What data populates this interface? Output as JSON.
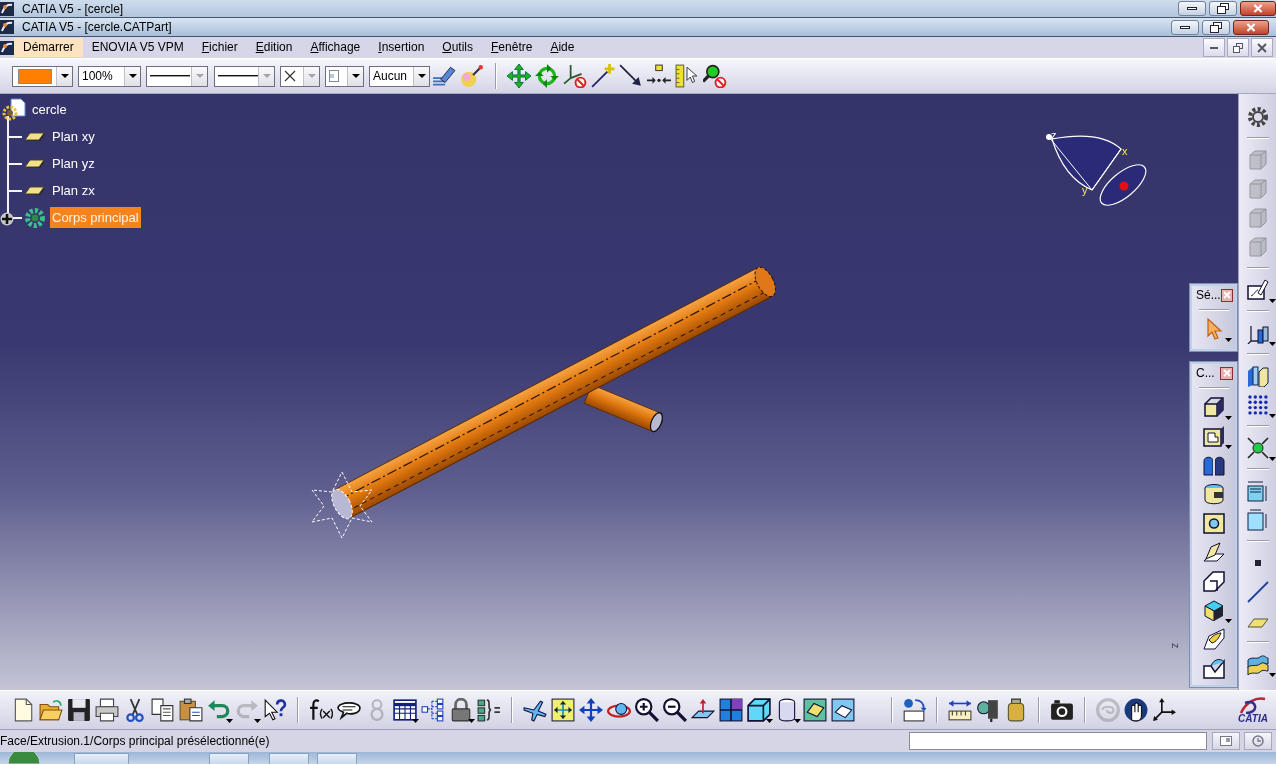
{
  "window": {
    "title": "CATIA V5 - [cercle]"
  },
  "document_window": {
    "title": "CATIA V5 - [cercle.CATPart]"
  },
  "menu_bar": [
    {
      "label": "Démarrer",
      "selected": true,
      "mnemonic": false
    },
    {
      "label": "ENOVIA V5 VPM",
      "selected": false,
      "mnemonic": false
    },
    {
      "label": "Fichier",
      "selected": false,
      "mnemonic": true
    },
    {
      "label": "Edition",
      "selected": false,
      "mnemonic": true
    },
    {
      "label": "Affichage",
      "selected": false,
      "mnemonic": true
    },
    {
      "label": "Insertion",
      "selected": false,
      "mnemonic": true
    },
    {
      "label": "Outils",
      "selected": false,
      "mnemonic": true
    },
    {
      "label": "Fenêtre",
      "selected": false,
      "mnemonic": true
    },
    {
      "label": "Aide",
      "selected": false,
      "mnemonic": true
    }
  ],
  "properties_toolbar": {
    "dropdowns": [
      {
        "kind": "color",
        "color": "#ff8000",
        "disabled": false
      },
      {
        "kind": "percent",
        "value": "100%",
        "disabled": false
      },
      {
        "kind": "thickness",
        "disabled": true
      },
      {
        "kind": "linetype",
        "disabled": true
      },
      {
        "kind": "point",
        "disabled": true
      },
      {
        "kind": "render",
        "disabled": false
      },
      {
        "kind": "layer",
        "value": "Aucun",
        "disabled": false
      }
    ],
    "groups": [
      {
        "buttons": [
          {
            "disabled": false
          },
          {
            "disabled": false
          }
        ]
      },
      {
        "buttons": [
          {
            "disabled": false
          },
          {
            "disabled": false
          },
          {
            "disabled": false
          },
          {
            "disabled": false
          },
          {
            "disabled": false
          },
          {
            "disabled": false
          },
          {
            "disabled": false
          },
          {
            "disabled": false
          }
        ]
      }
    ]
  },
  "tree": {
    "label": "cercle",
    "kind": "part",
    "selected": false,
    "children": [
      {
        "label": "Plan xy",
        "kind": "plane",
        "selected": false
      },
      {
        "label": "Plan yz",
        "kind": "plane",
        "selected": false
      },
      {
        "label": "Plan zx",
        "kind": "plane",
        "selected": false
      },
      {
        "label": "Corps principal",
        "kind": "body",
        "selected": true,
        "expanded": false
      }
    ]
  },
  "compass": {
    "z_label": "z",
    "x_label": "x",
    "y_label": "y"
  },
  "axis_triad": {
    "label": "z"
  },
  "floating_toolbars": [
    {
      "title": "Sé...",
      "buttons": [
        {
          "disabled": false
        }
      ]
    },
    {
      "title": "C...",
      "buttons": [
        {
          "disabled": false
        },
        {
          "disabled": false
        },
        {
          "disabled": false
        },
        {
          "disabled": false
        },
        {
          "disabled": false
        },
        {
          "disabled": false
        },
        {
          "disabled": false
        },
        {
          "disabled": false
        },
        {
          "disabled": false
        },
        {
          "disabled": false
        }
      ]
    }
  ],
  "right_toolbar": {
    "groups": [
      {
        "buttons": [
          {
            "disabled": false
          }
        ]
      },
      {
        "buttons": [
          {
            "disabled": true
          },
          {
            "disabled": true
          },
          {
            "disabled": true
          },
          {
            "disabled": true
          }
        ]
      },
      {
        "buttons": [
          {
            "disabled": false
          }
        ]
      },
      {
        "buttons": [
          {
            "disabled": false
          }
        ]
      },
      {
        "buttons": [
          {
            "disabled": false
          },
          {
            "disabled": false
          }
        ]
      },
      {
        "buttons": [
          {
            "disabled": false
          }
        ]
      },
      {
        "buttons": [
          {
            "disabled": false
          },
          {
            "disabled": false
          }
        ]
      },
      {
        "buttons": [
          {
            "disabled": false
          },
          {
            "disabled": false
          },
          {
            "disabled": false
          }
        ]
      },
      {
        "buttons": [
          {
            "disabled": false
          }
        ]
      }
    ]
  },
  "standard_toolbar": {
    "groups": [
      {
        "buttons": [
          {
            "disabled": false
          },
          {
            "disabled": false
          },
          {
            "disabled": false
          },
          {
            "disabled": false
          },
          {
            "disabled": false
          },
          {
            "disabled": false
          },
          {
            "disabled": false
          },
          {
            "disabled": false
          },
          {
            "disabled": true
          },
          {
            "disabled": false
          }
        ]
      },
      {
        "buttons": [
          {
            "disabled": false
          },
          {
            "disabled": false
          },
          {
            "disabled": true
          },
          {
            "disabled": false
          },
          {
            "disabled": false
          },
          {
            "disabled": false
          },
          {
            "disabled": false
          }
        ]
      },
      {
        "buttons": [
          {
            "disabled": false
          },
          {
            "disabled": false
          },
          {
            "disabled": false
          },
          {
            "disabled": false
          },
          {
            "disabled": false
          },
          {
            "disabled": false
          },
          {
            "disabled": false
          },
          {
            "disabled": false
          },
          {
            "disabled": false
          },
          {
            "disabled": false
          },
          {
            "disabled": false
          },
          {
            "disabled": false
          }
        ]
      },
      {
        "buttons": [
          {
            "disabled": false
          }
        ]
      },
      {
        "buttons": [
          {
            "disabled": false
          },
          {
            "disabled": false
          },
          {
            "disabled": false
          }
        ]
      },
      {
        "buttons": [
          {
            "disabled": false
          }
        ]
      },
      {
        "buttons": [
          {
            "disabled": true
          },
          {
            "disabled": false
          },
          {
            "disabled": false
          }
        ]
      }
    ]
  },
  "logo": {
    "text": "CATIA"
  },
  "status_bar": {
    "message": "Face/Extrusion.1/Corps principal présélectionné(e)"
  }
}
